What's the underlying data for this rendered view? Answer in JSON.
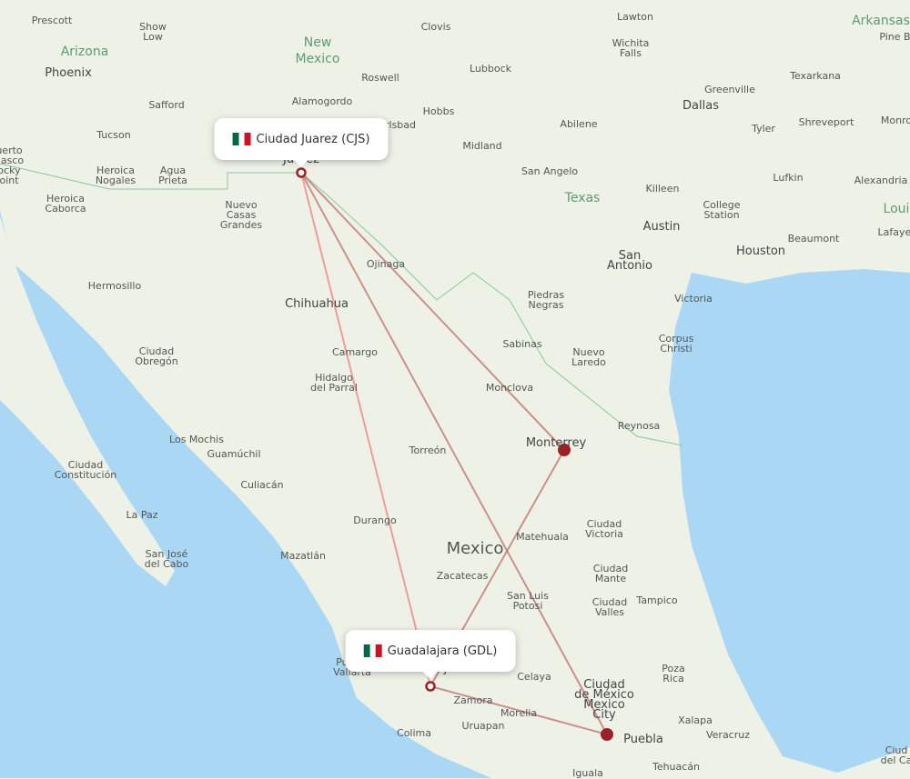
{
  "map": {
    "colors": {
      "land": "#eef2e6",
      "water": "#aad8f4",
      "route": "#c0706f",
      "route_direct": "#f08080",
      "airport": "#9b2226"
    },
    "origin": {
      "label": "Ciudad Juarez (CJS)",
      "flag": "mexico-flag-icon"
    },
    "destination": {
      "label": "Guadalajara (GDL)",
      "flag": "mexico-flag-icon"
    },
    "stopovers": [
      "Monterrey",
      "Mexico City"
    ],
    "labels": [
      "Prescott",
      "Show\nLow",
      "Arizona",
      "Phoenix",
      "Safford",
      "Tucson",
      "Heroica\nNogales",
      "Agua\nPrieta",
      "Heroica\nCaborca",
      "uerto\nñasco\nocky\noint",
      "New\nMexico",
      "Clovis",
      "Roswell",
      "Alamogordo",
      "rlsbad",
      "Hobbs",
      "Lubbock",
      "Midland",
      "Lawton",
      "Wichita\nFalls",
      "Dallas",
      "Abilene",
      "Tyler",
      "San Angelo",
      "Texas",
      "Killeen",
      "Austin",
      "College\nStation",
      "San\nAntonio",
      "Houston",
      "Lufkin",
      "Beaumont",
      "Arkansas",
      "Pine Bl",
      "Texarkana",
      "Shreveport",
      "Monro",
      "Alexandria",
      "Loui",
      "Lafayet",
      "Greenville",
      "Nuevo\nCasas\nGrandes",
      "Ojinaga",
      "Hermosillo",
      "Chihuahua",
      "Camargo",
      "Hidalgo\ndel Parral",
      "Ciudad\nObregón",
      "Los Mochis",
      "Guamúchil",
      "Culiacán",
      "Ciudad\nConstitución",
      "La Paz",
      "San José\ndel Cabo",
      "Mazatlán",
      "Durango",
      "Torreón",
      "Monclova",
      "Sabinas",
      "Piedras\nNegras",
      "Nuevo\nLaredo",
      "Victoria",
      "Corpus\nChristi",
      "Reynosa",
      "Monterrey",
      "Mexico",
      "Matehuala",
      "Ciudad\nVictoria",
      "Zacatecas",
      "San Luis\nPotosi",
      "Ciudad\nMante",
      "Ciudad\nValles",
      "Tampico",
      "Poza\nRica",
      "Celaya",
      "Zamora",
      "Morelia",
      "Uruapan",
      "Colima",
      "Ciudad\nde México\nMexico\nCity",
      "Puebla",
      "Xalapa",
      "Veracruz",
      "Tehuacán",
      "Iguala",
      "Ciud\ndel Ca",
      "Puerto\nVallarta",
      "Juarez",
      "Guadalajara"
    ]
  }
}
